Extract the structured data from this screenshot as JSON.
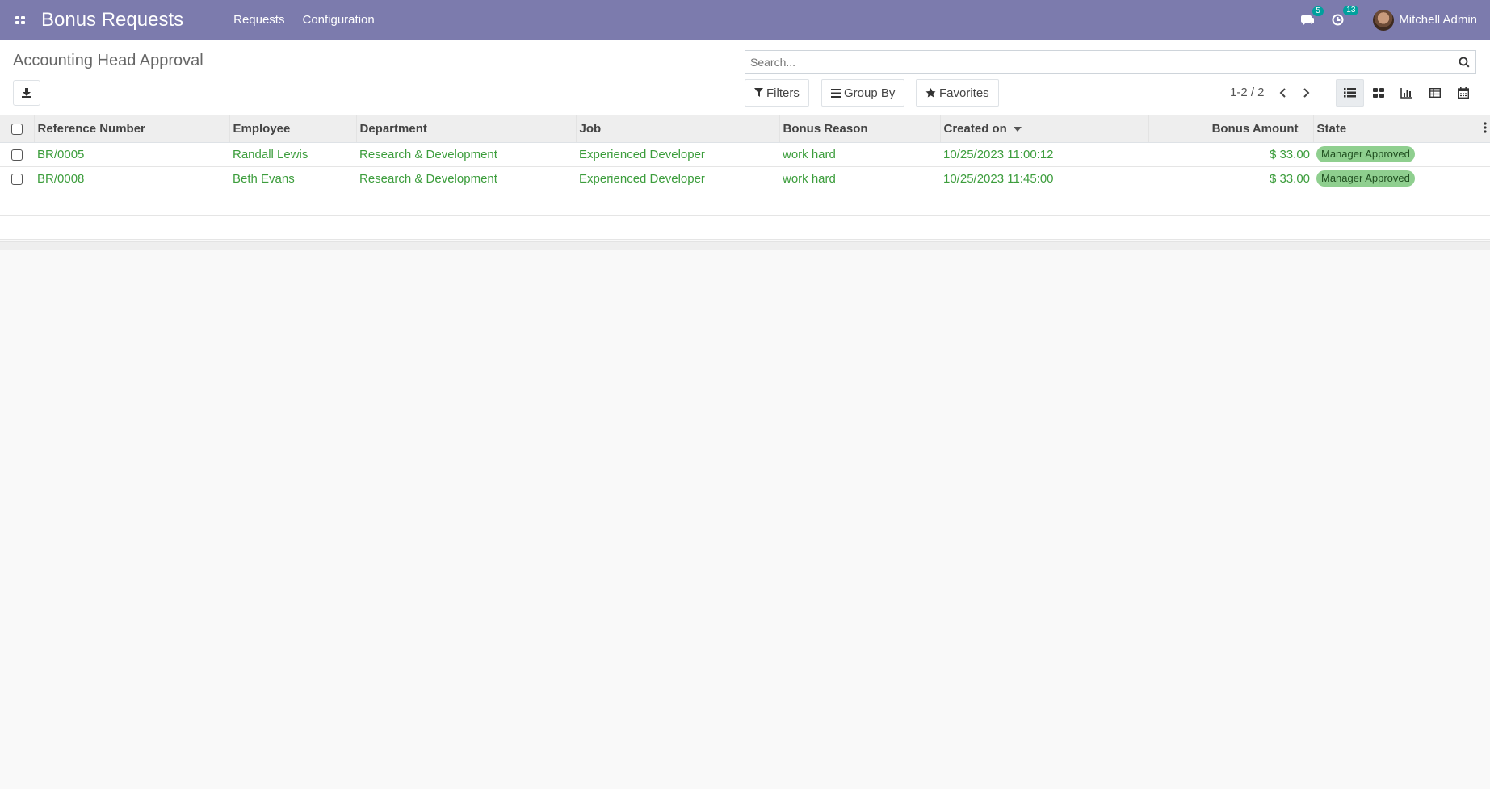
{
  "navbar": {
    "app_title": "Bonus Requests",
    "menu": [
      "Requests",
      "Configuration"
    ],
    "messages_count": "5",
    "activities_count": "13",
    "user_name": "Mitchell Admin",
    "color": "#7c7bad"
  },
  "control_panel": {
    "title": "Accounting Head Approval",
    "search_placeholder": "Search...",
    "filters_label": "Filters",
    "group_by_label": "Group By",
    "favorites_label": "Favorites",
    "pager": "1-2 / 2",
    "views": [
      "list-view-icon",
      "kanban-view-icon",
      "graph-view-icon",
      "pivot-view-icon",
      "calendar-view-icon"
    ],
    "active_view": "list"
  },
  "table": {
    "columns": [
      "Reference Number",
      "Employee",
      "Department",
      "Job",
      "Bonus Reason",
      "Created on",
      "Bonus Amount",
      "State"
    ],
    "sorted_column": "Created on",
    "rows": [
      {
        "reference": "BR/0005",
        "employee": "Randall Lewis",
        "department": "Research & Development",
        "job": "Experienced Developer",
        "reason": "work hard",
        "created_on": "10/25/2023 11:00:12",
        "amount": "$ 33.00",
        "state": "Manager Approved"
      },
      {
        "reference": "BR/0008",
        "employee": "Beth Evans",
        "department": "Research & Development",
        "job": "Experienced Developer",
        "reason": "work hard",
        "created_on": "10/25/2023 11:45:00",
        "amount": "$ 33.00",
        "state": "Manager Approved"
      }
    ],
    "row_text_color": "#3c9d3c",
    "badge_color": "#8fcf8f"
  }
}
